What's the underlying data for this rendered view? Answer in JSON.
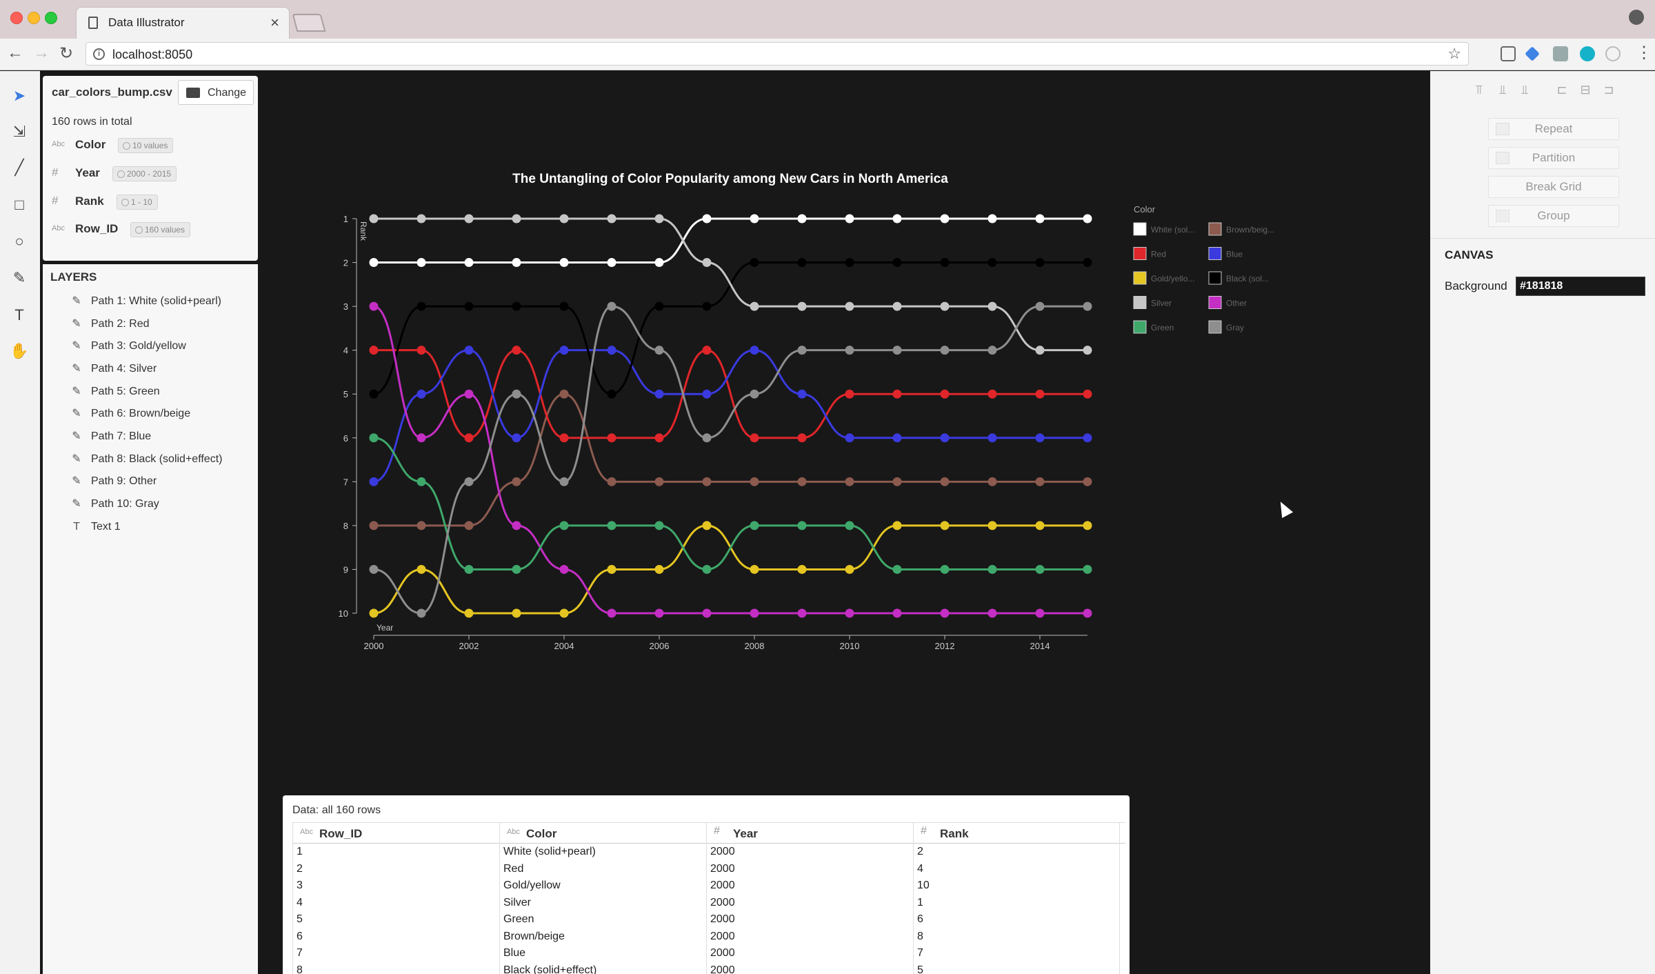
{
  "browser": {
    "tab_title": "Data Illustrator",
    "tab_close": "×",
    "url": "localhost:8050"
  },
  "tools": [
    "select-icon",
    "direct-select-icon",
    "line-icon",
    "rectangle-icon",
    "circle-icon",
    "pen-icon",
    "text-icon",
    "hand-icon"
  ],
  "dataset": {
    "file_name": "car_colors_bump.csv",
    "change_label": "Change",
    "rows_total": "160 rows in total",
    "fields": [
      {
        "type": "Abc",
        "name": "Color",
        "range": "10 values"
      },
      {
        "type": "#",
        "name": "Year",
        "range": "2000 - 2015"
      },
      {
        "type": "#",
        "name": "Rank",
        "range": "1 - 10"
      },
      {
        "type": "Abc",
        "name": "Row_ID",
        "range": "160 values"
      }
    ]
  },
  "layers": {
    "title": "LAYERS",
    "items": [
      "Path 1: White (solid+pearl)",
      "Path 2: Red",
      "Path 3: Gold/yellow",
      "Path 4: Silver",
      "Path 5: Green",
      "Path 6: Brown/beige",
      "Path 7: Blue",
      "Path 8: Black (solid+effect)",
      "Path 9: Other",
      "Path 10: Gray",
      "Text 1"
    ]
  },
  "right_panel": {
    "buttons": [
      "Repeat",
      "Partition",
      "Break Grid",
      "Group"
    ],
    "canvas_title": "CANVAS",
    "background_label": "Background",
    "background_value": "#181818"
  },
  "data_table": {
    "title": "Data: all 160 rows",
    "columns": [
      {
        "type": "Abc",
        "name": "Row_ID"
      },
      {
        "type": "Abc",
        "name": "Color"
      },
      {
        "type": "#",
        "name": "Year"
      },
      {
        "type": "#",
        "name": "Rank"
      }
    ],
    "rows": [
      [
        "1",
        "White (solid+pearl)",
        "2000",
        "2"
      ],
      [
        "2",
        "Red",
        "2000",
        "4"
      ],
      [
        "3",
        "Gold/yellow",
        "2000",
        "10"
      ],
      [
        "4",
        "Silver",
        "2000",
        "1"
      ],
      [
        "5",
        "Green",
        "2000",
        "6"
      ],
      [
        "6",
        "Brown/beige",
        "2000",
        "8"
      ],
      [
        "7",
        "Blue",
        "2000",
        "7"
      ],
      [
        "8",
        "Black (solid+effect)",
        "2000",
        "5"
      ]
    ]
  },
  "chart_data": {
    "type": "line",
    "title": "The Untangling of Color Popularity among New Cars in North America",
    "xlabel": "Year",
    "ylabel": "Rank",
    "x": [
      2000,
      2001,
      2002,
      2003,
      2004,
      2005,
      2006,
      2007,
      2008,
      2009,
      2010,
      2011,
      2012,
      2013,
      2014,
      2015
    ],
    "x_ticks": [
      2000,
      2002,
      2004,
      2006,
      2008,
      2010,
      2012,
      2014
    ],
    "y_ticks": [
      1,
      2,
      3,
      4,
      5,
      6,
      7,
      8,
      9,
      10
    ],
    "xlim": [
      2000,
      2015
    ],
    "ylim": [
      1,
      10
    ],
    "y_reversed": true,
    "legend_title": "Color",
    "legend_position": "right",
    "series": [
      {
        "name": "White (sol...",
        "color": "#ffffff",
        "values": [
          2,
          2,
          2,
          2,
          2,
          2,
          2,
          1,
          1,
          1,
          1,
          1,
          1,
          1,
          1,
          1
        ]
      },
      {
        "name": "Brown/beig...",
        "color": "#8c5a4f",
        "values": [
          8,
          8,
          8,
          7,
          5,
          7,
          7,
          7,
          7,
          7,
          7,
          7,
          7,
          7,
          7,
          7
        ]
      },
      {
        "name": "Red",
        "color": "#e0262a",
        "values": [
          4,
          4,
          6,
          4,
          6,
          6,
          6,
          4,
          6,
          6,
          5,
          5,
          5,
          5,
          5,
          5
        ]
      },
      {
        "name": "Blue",
        "color": "#3a3adf",
        "values": [
          7,
          5,
          4,
          6,
          4,
          4,
          5,
          5,
          4,
          5,
          6,
          6,
          6,
          6,
          6,
          6
        ]
      },
      {
        "name": "Gold/yello...",
        "color": "#e5c522",
        "values": [
          10,
          9,
          10,
          10,
          10,
          9,
          9,
          8,
          9,
          9,
          9,
          8,
          8,
          8,
          8,
          8
        ]
      },
      {
        "name": "Black (sol...",
        "color": "#000000",
        "values": [
          5,
          3,
          3,
          3,
          3,
          5,
          3,
          3,
          2,
          2,
          2,
          2,
          2,
          2,
          2,
          2
        ]
      },
      {
        "name": "Silver",
        "color": "#c6c6c6",
        "values": [
          1,
          1,
          1,
          1,
          1,
          1,
          1,
          2,
          3,
          3,
          3,
          3,
          3,
          3,
          4,
          4
        ]
      },
      {
        "name": "Other",
        "color": "#c42ec4",
        "values": [
          3,
          6,
          5,
          8,
          9,
          10,
          10,
          10,
          10,
          10,
          10,
          10,
          10,
          10,
          10,
          10
        ]
      },
      {
        "name": "Green",
        "color": "#3fa86b",
        "values": [
          6,
          7,
          9,
          9,
          8,
          8,
          8,
          9,
          8,
          8,
          8,
          9,
          9,
          9,
          9,
          9
        ]
      },
      {
        "name": "Gray",
        "color": "#8e8e8e",
        "values": [
          9,
          10,
          7,
          5,
          7,
          3,
          4,
          6,
          5,
          4,
          4,
          4,
          4,
          4,
          3,
          3
        ]
      }
    ]
  }
}
